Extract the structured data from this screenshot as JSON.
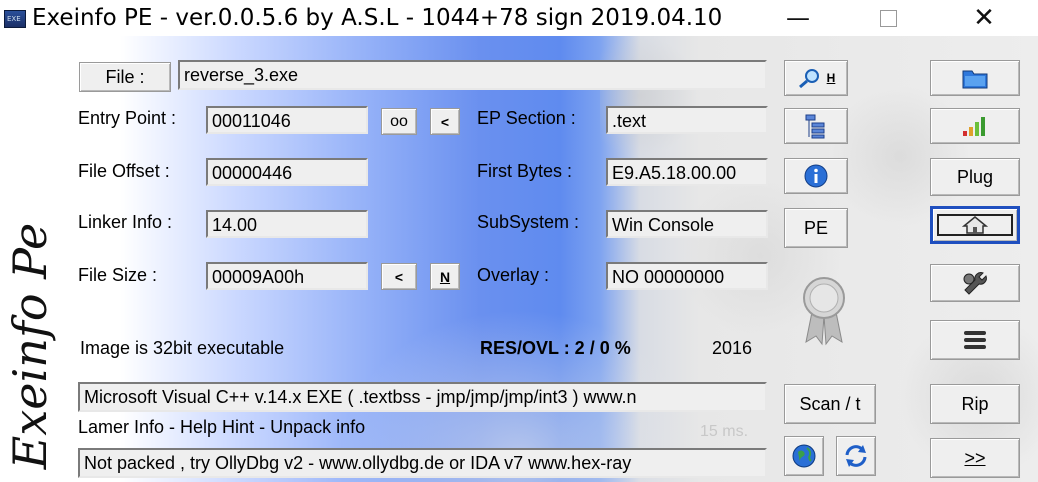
{
  "window": {
    "title": "Exeinfo PE - ver.0.0.5.6  by A.S.L -  1044+78 sign  2019.04.10",
    "icon_label": "EXE",
    "controls": {
      "minimize": "—",
      "close": "✕"
    }
  },
  "logo_text": "Exeinfo Pe",
  "file": {
    "button_label": "File :",
    "value": "reverse_3.exe"
  },
  "entry_point": {
    "label": "Entry Point :",
    "value": "00011046",
    "oo_label": "oo",
    "prev_label": "<"
  },
  "ep_section": {
    "label": "EP Section :",
    "value": ".text"
  },
  "file_offset": {
    "label": "File Offset :",
    "value": "00000446"
  },
  "first_bytes": {
    "label": "First Bytes :",
    "value": "E9.A5.18.00.00"
  },
  "linker_info": {
    "label": "Linker Info :",
    "value": "14.00"
  },
  "subsystem": {
    "label": "SubSystem :",
    "value": "Win Console"
  },
  "file_size": {
    "label": "File Size :",
    "value": "00009A00h",
    "prev_label": "<",
    "n_label": "N"
  },
  "overlay": {
    "label": "Overlay :",
    "value": "NO   00000000"
  },
  "image_info": "Image is 32bit executable",
  "res_ovl": "RES/OVL : 2 / 0 %",
  "year": "2016",
  "detection": "Microsoft Visual C++ v.14.x EXE ( .textbss - jmp/jmp/jmp/int3 ) www.n",
  "lamer_info": "Lamer Info - Help Hint - Unpack info",
  "scan_time": "15 ms.",
  "hint": "Not packed , try OllyDbg v2 - www.ollydbg.de or IDA v7 www.hex-ray",
  "mid_buttons": {
    "search_hotkey": "H",
    "pe_label": "PE",
    "scan_label": "Scan / t"
  },
  "right_buttons": {
    "plug_label": "Plug",
    "rip_label": "Rip",
    "next_label": ">>"
  },
  "colors": {
    "gradient_blue": "#5f8bef",
    "field_bg": "#efefef",
    "house_border": "#1f4fbf"
  }
}
